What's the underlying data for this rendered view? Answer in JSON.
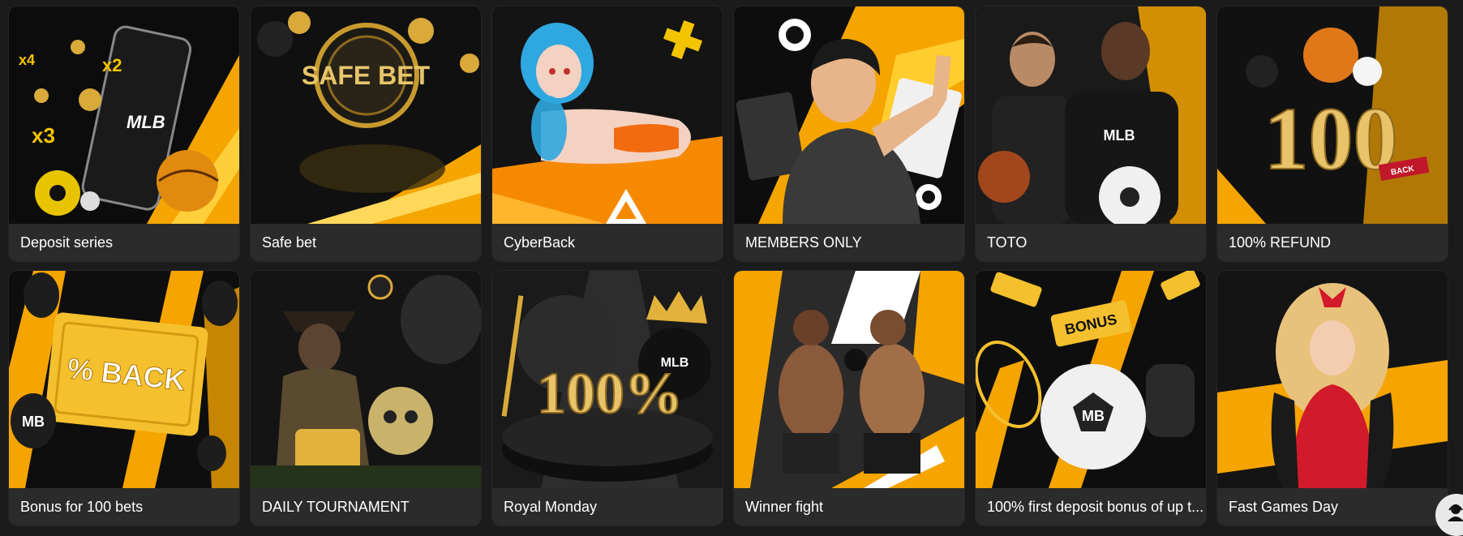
{
  "promotions": [
    {
      "title": "Deposit series",
      "art": "phone-with-balls-art",
      "badge_text": "MLB",
      "badges": [
        "x4",
        "x2",
        "x3"
      ]
    },
    {
      "title": "Safe bet",
      "art": "safe-bet-coin-art",
      "badge_text": "SAFE BET"
    },
    {
      "title": "CyberBack",
      "art": "anime-girl-art"
    },
    {
      "title": "MEMBERS ONLY",
      "art": "thumbs-up-man-art"
    },
    {
      "title": "TOTO",
      "art": "athletes-art",
      "badge_text": "MLB"
    },
    {
      "title": "100% REFUND",
      "art": "gold-100-art",
      "badge_text": "100",
      "badge_sub": "BACK"
    },
    {
      "title": "Bonus for 100 bets",
      "art": "percent-back-ticket-art",
      "badge_text": "% BACK",
      "logo_text": "MB"
    },
    {
      "title": "DAILY TOURNAMENT",
      "art": "cowboy-dragon-art"
    },
    {
      "title": "Royal Monday",
      "art": "royal-100-art",
      "badge_text": "100%",
      "logo_text": "MLB"
    },
    {
      "title": "Winner fight",
      "art": "boxers-art"
    },
    {
      "title": "100% first deposit bonus of up t...",
      "art": "bonus-ball-art",
      "badge_text": "BONUS",
      "logo_text": "MB"
    },
    {
      "title": "Fast Games Day",
      "art": "red-dress-girl-art"
    }
  ],
  "colors": {
    "accent": "#f5a400",
    "card_bg": "#2b2b2b",
    "page_bg": "#1b1b1b",
    "gold": "#d9a93a"
  },
  "support_button": {
    "icon": "support-agent-icon"
  }
}
